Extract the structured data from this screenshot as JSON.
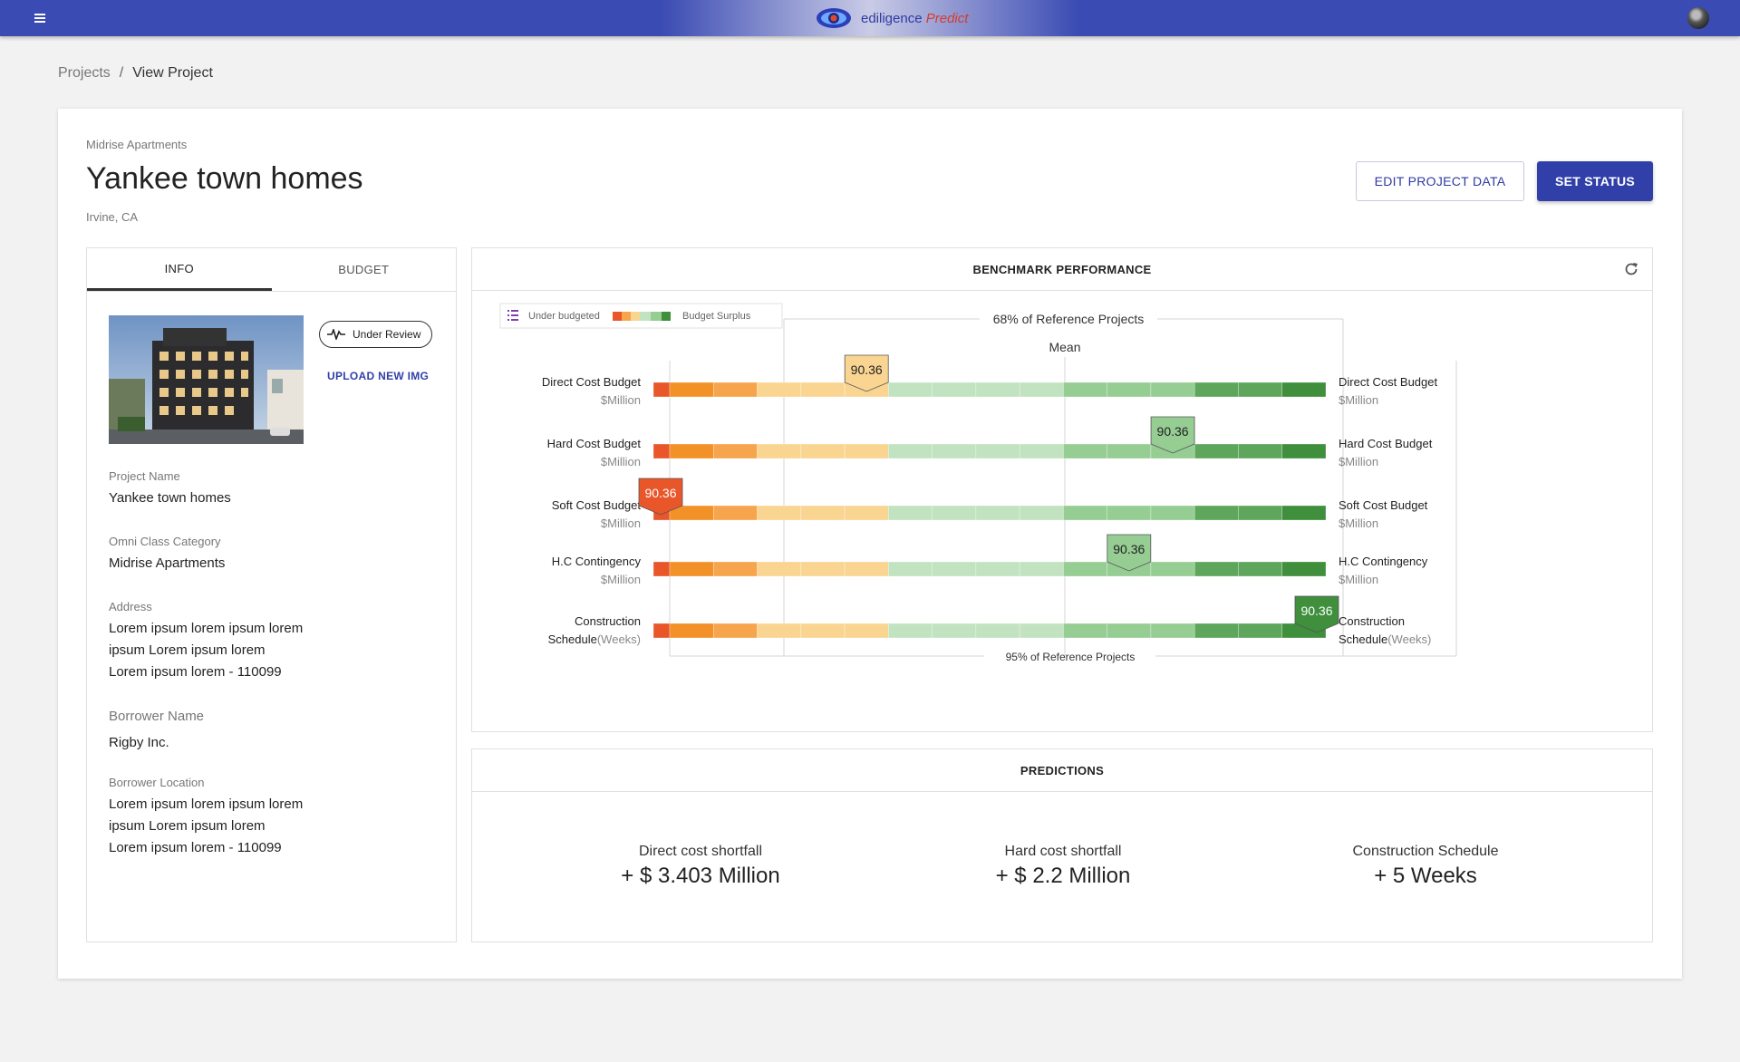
{
  "header": {
    "brand_name": "ediligence",
    "brand_product": "Predict",
    "menu_icon": "hamburger-icon",
    "avatar": "user-avatar"
  },
  "breadcrumb": {
    "items": [
      "Projects",
      "View Project"
    ],
    "separator": "/"
  },
  "project": {
    "category": "Midrise Apartments",
    "title": "Yankee town homes",
    "location": "Irvine, CA"
  },
  "actions": {
    "edit_label": "EDIT PROJECT DATA",
    "status_label": "SET STATUS"
  },
  "info_panel": {
    "tabs": [
      "INFO",
      "BUDGET"
    ],
    "active_tab": "INFO",
    "status_chip": "Under Review",
    "upload_label": "UPLOAD NEW IMG",
    "fields": [
      {
        "label": "Project Name",
        "lines": [
          "Yankee town homes"
        ]
      },
      {
        "label": "Omni Class Category",
        "lines": [
          "Midrise Apartments"
        ]
      },
      {
        "label": "Address",
        "lines": [
          "Lorem ipsum lorem ipsum lorem",
          "ipsum Lorem ipsum lorem",
          "Lorem ipsum lorem - 110099"
        ]
      },
      {
        "label": "Borrower Name",
        "lines": [
          "Rigby Inc."
        ]
      },
      {
        "label": "Borrower Location",
        "lines": [
          "Lorem ipsum lorem ipsum lorem",
          "ipsum Lorem ipsum lorem",
          "Lorem ipsum lorem - 110099"
        ]
      }
    ]
  },
  "benchmark": {
    "title": "BENCHMARK PERFORMANCE",
    "legend": {
      "left": "Under budgeted",
      "right": "Budget Surplus"
    },
    "top_band_label": "68% of Reference Projects",
    "mean_label": "Mean",
    "bottom_band_label": "95% of Reference Projects"
  },
  "chart_data": {
    "type": "bar",
    "title": "BENCHMARK PERFORMANCE",
    "scale": "Under budgeted to Budget Surplus",
    "segment_colors": [
      "#e8562a",
      "#f29127",
      "#f7a54c",
      "#fad592",
      "#fad592",
      "#fad592",
      "#c2e3c0",
      "#c2e3c0",
      "#c2e3c0",
      "#c2e3c0",
      "#95cd93",
      "#95cd93",
      "#95cd93",
      "#5da65b",
      "#5da65b",
      "#3f8f3d"
    ],
    "rows": [
      {
        "name": "Direct Cost Budget",
        "unit": "$Million",
        "value": 90.36,
        "position_segment": 5
      },
      {
        "name": "Hard Cost Budget",
        "unit": "$Million",
        "value": 90.36,
        "position_segment": 12
      },
      {
        "name": "Soft Cost Budget",
        "unit": "$Million",
        "value": 90.36,
        "position_segment": 0
      },
      {
        "name": "H.C Contingency",
        "unit": "$Million",
        "value": 90.36,
        "position_segment": 11
      },
      {
        "name": "Construction Schedule",
        "unit": "(Weeks)",
        "value": 90.36,
        "position_segment": 15
      }
    ]
  },
  "predictions": {
    "title": "PREDICTIONS",
    "items": [
      {
        "label": "Direct cost shortfall",
        "value": "+ $ 3.403 Million"
      },
      {
        "label": "Hard cost shortfall",
        "value": "+ $ 2.2 Million"
      },
      {
        "label": "Construction Schedule",
        "value": "+ 5 Weeks"
      }
    ]
  }
}
